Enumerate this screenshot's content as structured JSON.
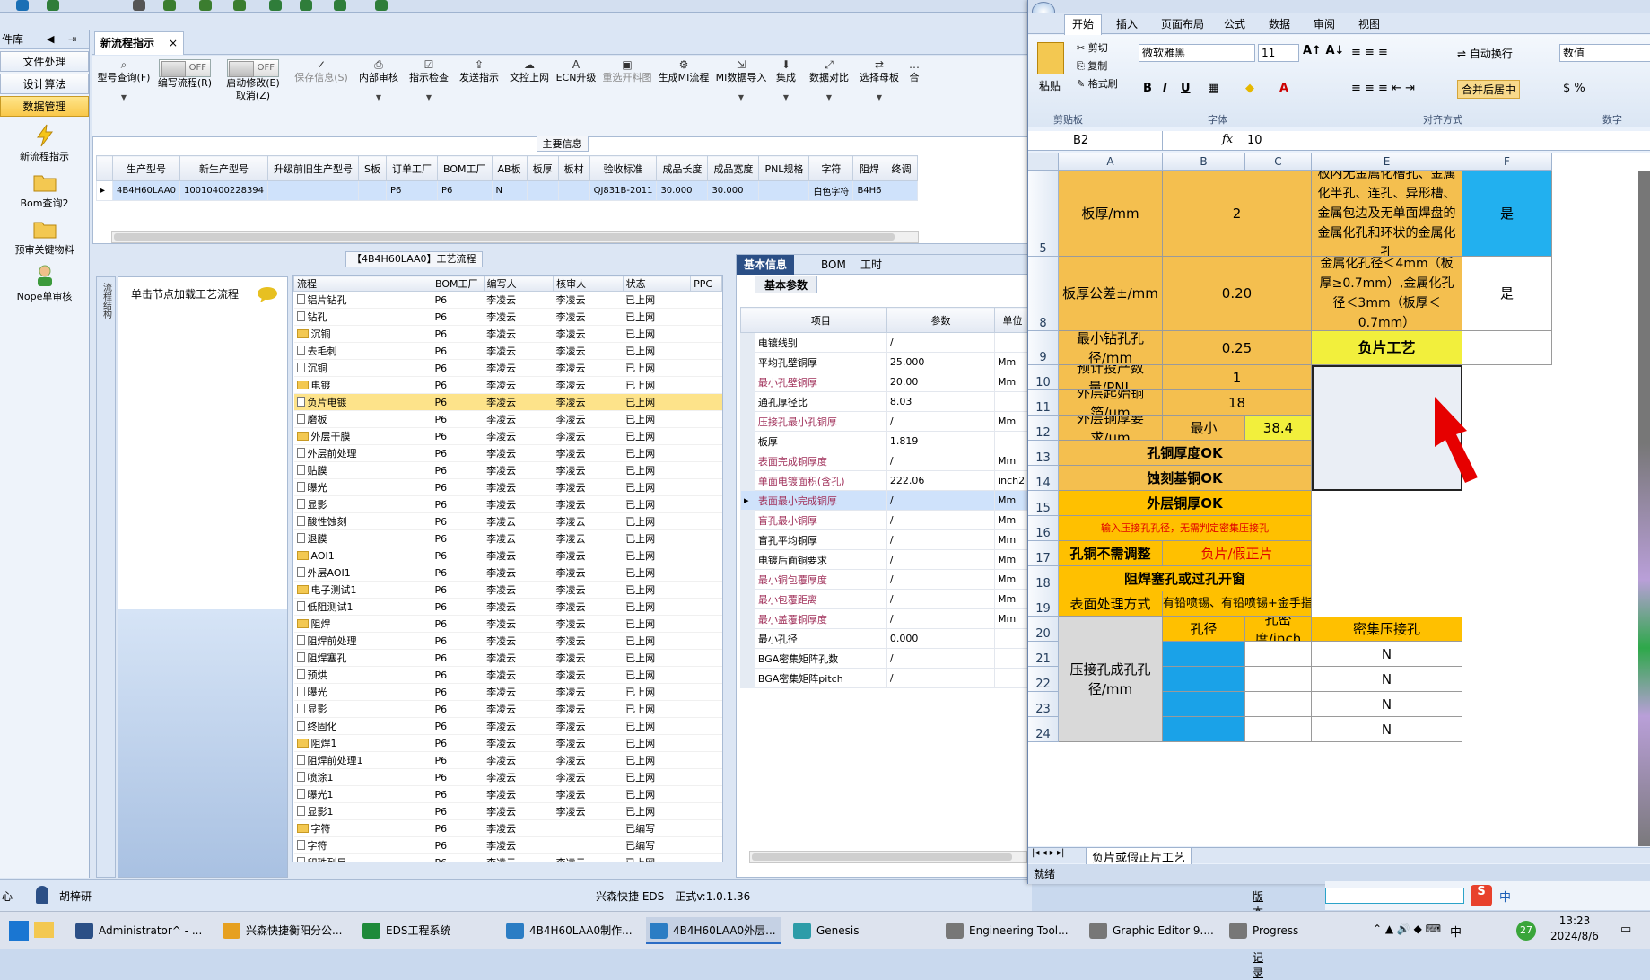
{
  "left_nav": {
    "header": "件库",
    "items": [
      "文件处理",
      "设计算法",
      "数据管理"
    ],
    "tools": [
      "新流程指示",
      "Bom查询2",
      "预审关键物料",
      "Nope单审核"
    ]
  },
  "doc_tab": {
    "label": "新流程指示",
    "close": "×"
  },
  "ribbon": {
    "query": "型号查询(F)",
    "edit_flow": "编写流程(R)",
    "enable_modify": "启动修改(E)",
    "cancel": "取消(Z)",
    "save_info": "保存信息(S)",
    "internal_review": "内部审核",
    "check": "指示检查",
    "send": "发送指示",
    "upload": "文控上网",
    "ecn": "ECN升级",
    "reselect": "重选开料图",
    "gen_mi": "生成MI流程",
    "mi_import": "MI数据导入",
    "assemble": "集成",
    "compare": "数据对比",
    "select_master": "选择母板",
    "more": "合",
    "off": "OFF"
  },
  "main_info": {
    "title": "主要信息",
    "columns": [
      "生产型号",
      "新生产型号",
      "升级前旧生产型号",
      "S板",
      "订单工厂",
      "BOM工厂",
      "AB板",
      "板厚",
      "板材",
      "验收标准",
      "成品长度",
      "成品宽度",
      "PNL规格",
      "字符",
      "阻焊",
      "终调"
    ],
    "row": [
      "4B4H60LAA0",
      "10010400228394",
      "",
      "",
      "P6",
      "P6",
      "N",
      "",
      "",
      "QJ831B-2011",
      "30.000",
      "30.000",
      "",
      "白色字符",
      "B4H6",
      ""
    ]
  },
  "flow": {
    "title": "【4B4H60LAA0】工艺流程",
    "side_tab": "流程结构",
    "node_hint": "单击节点加载工艺流程",
    "columns": [
      "流程",
      "BOM工厂",
      "编写人",
      "核审人",
      "状态",
      "PPC"
    ],
    "rows": [
      {
        "name": "铝片钻孔",
        "lvl": 2,
        "f": "P6",
        "w": "李凌云",
        "r": "李凌云",
        "s": "已上网"
      },
      {
        "name": "钻孔",
        "lvl": 2,
        "f": "P6",
        "w": "李凌云",
        "r": "李凌云",
        "s": "已上网"
      },
      {
        "name": "沉铜",
        "lvl": 1,
        "f": "P6",
        "w": "李凌云",
        "r": "李凌云",
        "s": "已上网"
      },
      {
        "name": "去毛刺",
        "lvl": 2,
        "f": "P6",
        "w": "李凌云",
        "r": "李凌云",
        "s": "已上网"
      },
      {
        "name": "沉铜",
        "lvl": 2,
        "f": "P6",
        "w": "李凌云",
        "r": "李凌云",
        "s": "已上网"
      },
      {
        "name": "电镀",
        "lvl": 1,
        "f": "P6",
        "w": "李凌云",
        "r": "李凌云",
        "s": "已上网"
      },
      {
        "name": "负片电镀",
        "lvl": 2,
        "f": "P6",
        "w": "李凌云",
        "r": "李凌云",
        "s": "已上网",
        "sel": true
      },
      {
        "name": "磨板",
        "lvl": 2,
        "f": "P6",
        "w": "李凌云",
        "r": "李凌云",
        "s": "已上网"
      },
      {
        "name": "外层干膜",
        "lvl": 1,
        "f": "P6",
        "w": "李凌云",
        "r": "李凌云",
        "s": "已上网"
      },
      {
        "name": "外层前处理",
        "lvl": 2,
        "f": "P6",
        "w": "李凌云",
        "r": "李凌云",
        "s": "已上网"
      },
      {
        "name": "贴膜",
        "lvl": 2,
        "f": "P6",
        "w": "李凌云",
        "r": "李凌云",
        "s": "已上网"
      },
      {
        "name": "曝光",
        "lvl": 2,
        "f": "P6",
        "w": "李凌云",
        "r": "李凌云",
        "s": "已上网"
      },
      {
        "name": "显影",
        "lvl": 2,
        "f": "P6",
        "w": "李凌云",
        "r": "李凌云",
        "s": "已上网"
      },
      {
        "name": "酸性蚀刻",
        "lvl": 2,
        "f": "P6",
        "w": "李凌云",
        "r": "李凌云",
        "s": "已上网"
      },
      {
        "name": "退膜",
        "lvl": 2,
        "f": "P6",
        "w": "李凌云",
        "r": "李凌云",
        "s": "已上网"
      },
      {
        "name": "AOI1",
        "lvl": 1,
        "f": "P6",
        "w": "李凌云",
        "r": "李凌云",
        "s": "已上网"
      },
      {
        "name": "外层AOI1",
        "lvl": 2,
        "f": "P6",
        "w": "李凌云",
        "r": "李凌云",
        "s": "已上网"
      },
      {
        "name": "电子测试1",
        "lvl": 1,
        "f": "P6",
        "w": "李凌云",
        "r": "李凌云",
        "s": "已上网"
      },
      {
        "name": "低阻测试1",
        "lvl": 2,
        "f": "P6",
        "w": "李凌云",
        "r": "李凌云",
        "s": "已上网"
      },
      {
        "name": "阻焊",
        "lvl": 1,
        "f": "P6",
        "w": "李凌云",
        "r": "李凌云",
        "s": "已上网"
      },
      {
        "name": "阻焊前处理",
        "lvl": 2,
        "f": "P6",
        "w": "李凌云",
        "r": "李凌云",
        "s": "已上网"
      },
      {
        "name": "阻焊塞孔",
        "lvl": 2,
        "f": "P6",
        "w": "李凌云",
        "r": "李凌云",
        "s": "已上网"
      },
      {
        "name": "预烘",
        "lvl": 2,
        "f": "P6",
        "w": "李凌云",
        "r": "李凌云",
        "s": "已上网"
      },
      {
        "name": "曝光",
        "lvl": 2,
        "f": "P6",
        "w": "李凌云",
        "r": "李凌云",
        "s": "已上网"
      },
      {
        "name": "显影",
        "lvl": 2,
        "f": "P6",
        "w": "李凌云",
        "r": "李凌云",
        "s": "已上网"
      },
      {
        "name": "终固化",
        "lvl": 2,
        "f": "P6",
        "w": "李凌云",
        "r": "李凌云",
        "s": "已上网"
      },
      {
        "name": "阻焊1",
        "lvl": 1,
        "f": "P6",
        "w": "李凌云",
        "r": "李凌云",
        "s": "已上网"
      },
      {
        "name": "阻焊前处理1",
        "lvl": 2,
        "f": "P6",
        "w": "李凌云",
        "r": "李凌云",
        "s": "已上网"
      },
      {
        "name": "喷涂1",
        "lvl": 2,
        "f": "P6",
        "w": "李凌云",
        "r": "李凌云",
        "s": "已上网"
      },
      {
        "name": "曝光1",
        "lvl": 2,
        "f": "P6",
        "w": "李凌云",
        "r": "李凌云",
        "s": "已上网"
      },
      {
        "name": "显影1",
        "lvl": 2,
        "f": "P6",
        "w": "李凌云",
        "r": "李凌云",
        "s": "已上网"
      },
      {
        "name": "字符",
        "lvl": 1,
        "f": "P6",
        "w": "李凌云",
        "r": "",
        "s": "已编写"
      },
      {
        "name": "字符",
        "lvl": 2,
        "f": "P6",
        "w": "李凌云",
        "r": "",
        "s": "已编写"
      },
      {
        "name": "印珠列目",
        "lvl": 2,
        "f": "P6",
        "w": "李凌云",
        "r": "李凌云",
        "s": "已上网"
      }
    ]
  },
  "info": {
    "tabs": [
      "基本信息",
      "BOM",
      "工时"
    ],
    "sub": "基本参数",
    "columns": [
      "项目",
      "参数",
      "单位"
    ],
    "rows": [
      {
        "k": "电镀线别",
        "v": "/",
        "u": "",
        "red": false
      },
      {
        "k": "平均孔壁铜厚",
        "v": "25.000",
        "u": "Μm",
        "red": false
      },
      {
        "k": "最小孔壁铜厚",
        "v": "20.00",
        "u": "Μm",
        "red": true
      },
      {
        "k": "通孔厚径比",
        "v": "8.03",
        "u": "",
        "red": false
      },
      {
        "k": "压接孔最小孔铜厚",
        "v": "/",
        "u": "Μm",
        "red": true
      },
      {
        "k": "板厚",
        "v": "1.819",
        "u": "",
        "red": false
      },
      {
        "k": "表面完成铜厚度",
        "v": "/",
        "u": "Μm",
        "red": true
      },
      {
        "k": "单面电镀面积(含孔)",
        "v": "222.06",
        "u": "inch2",
        "red": true
      },
      {
        "k": "表面最小完成铜厚",
        "v": "/",
        "u": "Μm",
        "red": true,
        "sel": true
      },
      {
        "k": "盲孔最小铜厚",
        "v": "/",
        "u": "Μm",
        "red": true
      },
      {
        "k": "盲孔平均铜厚",
        "v": "/",
        "u": "Μm",
        "red": false
      },
      {
        "k": "电镀后面铜要求",
        "v": "/",
        "u": "Μm",
        "red": false
      },
      {
        "k": "最小铜包覆厚度",
        "v": "/",
        "u": "Μm",
        "red": true
      },
      {
        "k": "最小包覆距离",
        "v": "/",
        "u": "Μm",
        "red": true
      },
      {
        "k": "最小盖覆铜厚度",
        "v": "/",
        "u": "Μm",
        "red": true
      },
      {
        "k": "最小孔径",
        "v": "0.000",
        "u": "",
        "red": false
      },
      {
        "k": "BGA密集矩阵孔数",
        "v": "/",
        "u": "",
        "red": false
      },
      {
        "k": "BGA密集矩阵pitch",
        "v": "/",
        "u": "",
        "red": false
      }
    ]
  },
  "status": {
    "left": "心",
    "user": "胡梓研",
    "center": "兴森快捷 EDS - 正式v:1.0.1.36",
    "right": "版本更新记录"
  },
  "excel": {
    "tabs": [
      "开始",
      "插入",
      "页面布局",
      "公式",
      "数据",
      "审阅",
      "视图"
    ],
    "clip": [
      "剪切",
      "复制",
      "格式刷",
      "粘贴",
      "剪贴板"
    ],
    "font_name": "微软雅黑",
    "font_size": "11",
    "font_grp": "字体",
    "align_grp": "对齐方式",
    "wrap": "自动换行",
    "merge": "合并后居中",
    "number_fmt": "数值",
    "number_grp": "数字",
    "cell_ref": "B2",
    "fx": "fx",
    "formula": "10",
    "cols": [
      "A",
      "B",
      "C",
      "E",
      "F"
    ],
    "rows": [
      "5",
      "8",
      "9",
      "10",
      "11",
      "12",
      "13",
      "14",
      "15",
      "16",
      "17",
      "18",
      "19",
      "20",
      "21",
      "22",
      "23",
      "24"
    ],
    "c": {
      "a5": "板厚/mm",
      "b5": "2",
      "e5": "板内无金属化槽孔、金属化半孔、连孔、异形槽、金属包边及无单面焊盘的金属化孔和环状的金属化孔",
      "f5": "是",
      "a8": "板厚公差±/mm",
      "b8": "0.20",
      "e8": "金属化孔径＜4mm（板厚≥0.7mm）,金属化孔径＜3mm（板厚＜0.7mm）",
      "f8": "是",
      "a9": "最小钻孔孔径/mm",
      "b9": "0.25",
      "e9": "负片工艺",
      "a10": "预计投产数量/PNL",
      "b10": "1",
      "a11": "外层起始铜箔/um",
      "b11": "18",
      "a12": "外层铜厚要求/um",
      "b12": "最小",
      "c12": "38.4",
      "r13": "孔铜厚度OK",
      "r14": "蚀刻基铜OK",
      "r15": "外层铜厚OK",
      "r16": "输入压接孔孔径，无需判定密集压接孔",
      "a17": "孔铜不需调整",
      "b17": "负片/假正片",
      "r18": "阻焊塞孔或过孔开窗",
      "a19": "表面处理方式",
      "b19": "有铅喷锡、有铅喷锡+金手指",
      "b20": "孔径",
      "c20": "孔密度/inch",
      "e20": "密集压接孔",
      "a20": "压接孔成孔孔径/mm",
      "n": "N"
    },
    "sheet": "负片或假正片工艺",
    "ready": "就绪"
  },
  "taskbar": {
    "items": [
      "Administrator^ - ...",
      "兴森快捷衡阳分公...",
      "EDS工程系统",
      "4B4H60LAA0制作...",
      "4B4H60LAA0外层...",
      "Genesis",
      "Engineering Tool...",
      "Graphic Editor 9....",
      "Progress"
    ],
    "time": "13:23",
    "date": "2024/8/6",
    "lang": "中",
    "badge": "27"
  },
  "colors": {
    "accent": "#2b4f86",
    "orange": "#f4bf4f",
    "yellow": "#f2ef3c",
    "blue": "#22b0ef",
    "arrow": "#e60000"
  }
}
